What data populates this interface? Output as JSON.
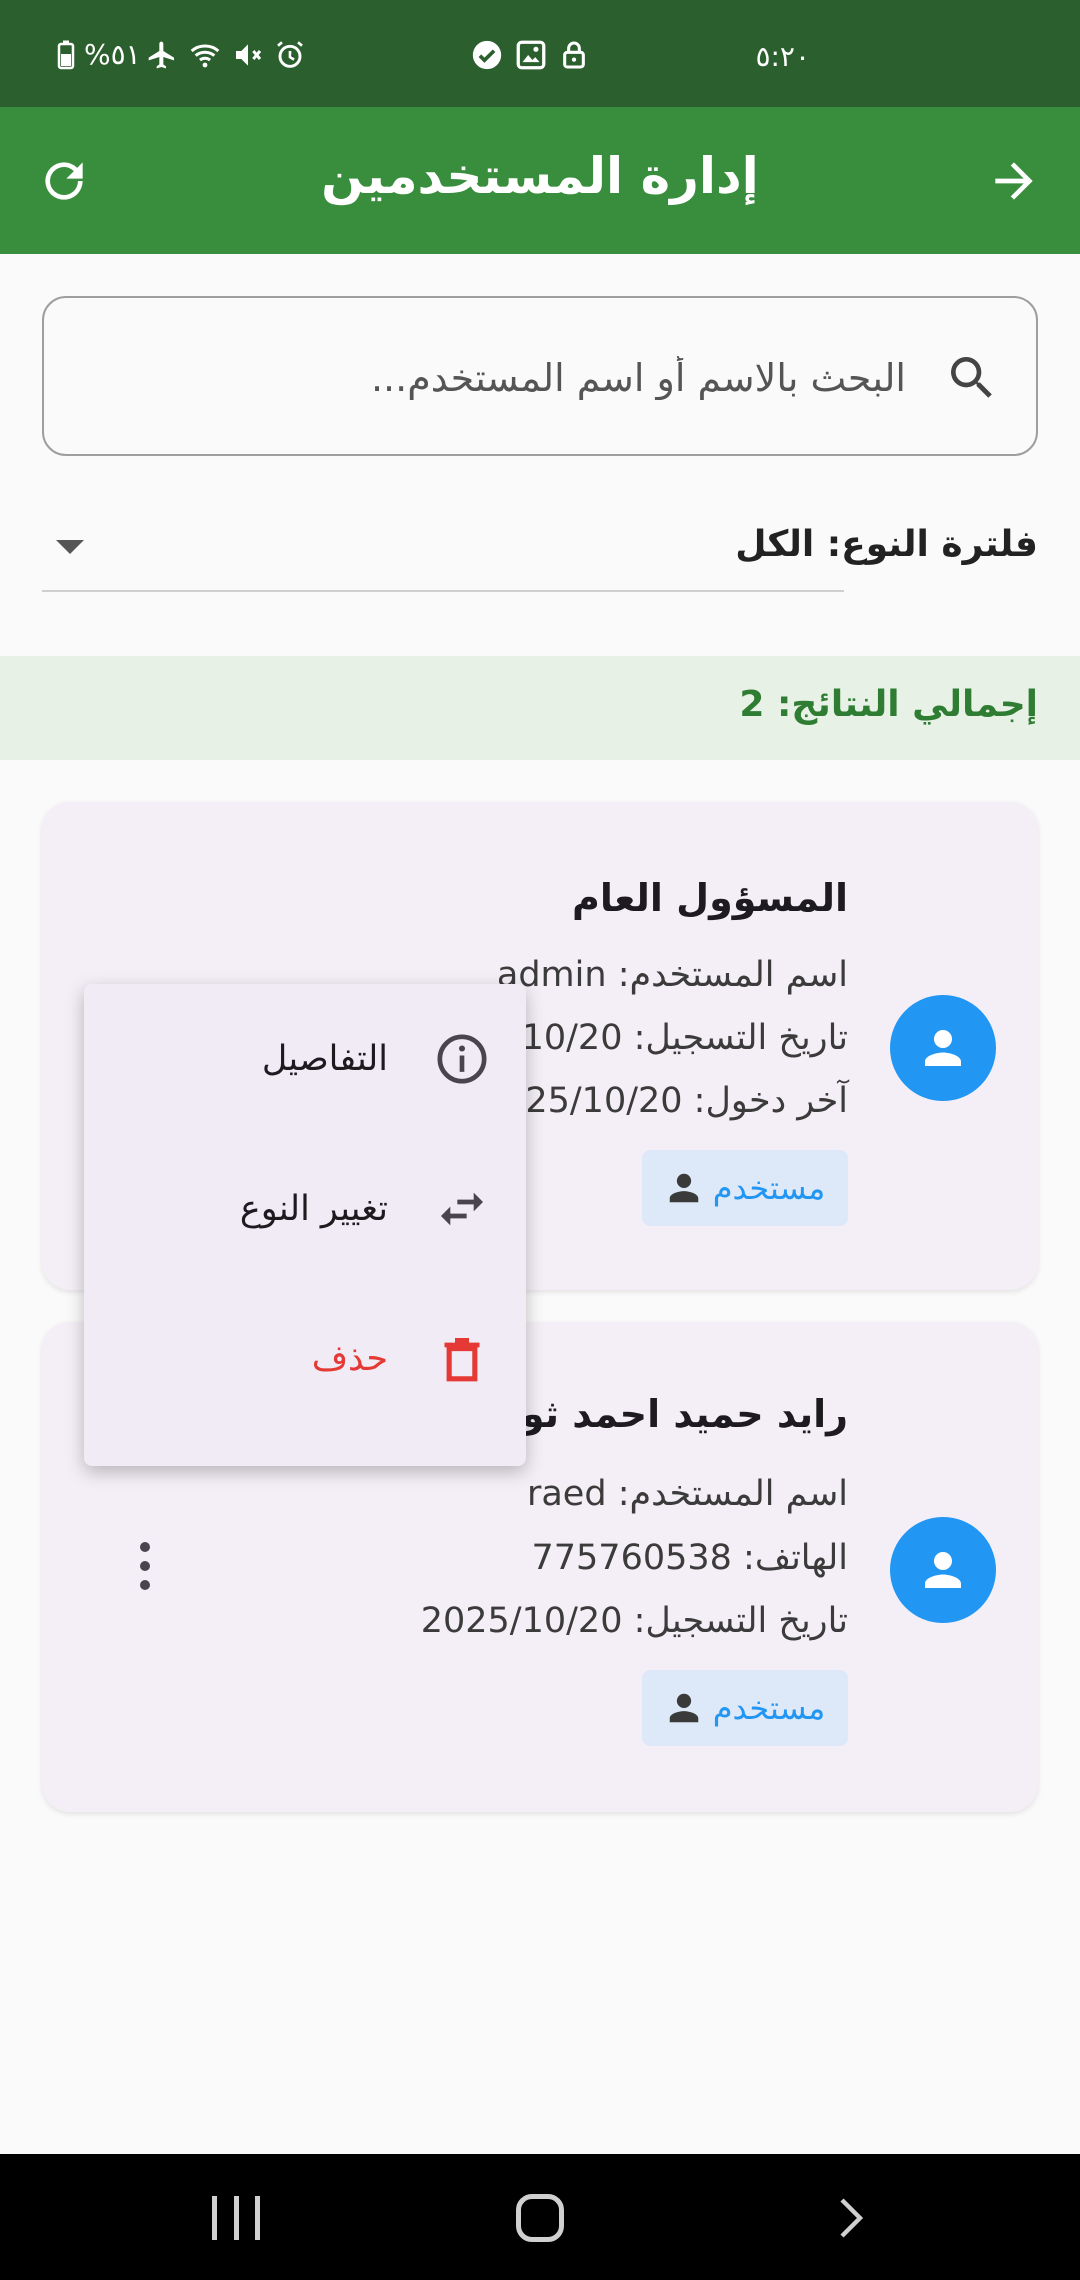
{
  "status_bar": {
    "time": "٥:٢٠",
    "battery": "%٥١"
  },
  "app_bar": {
    "title": "إدارة المستخدمين"
  },
  "search": {
    "placeholder": "البحث بالاسم أو اسم المستخدم..."
  },
  "filter": {
    "label": "فلترة النوع: الكل"
  },
  "results": {
    "text": "إجمالي النتائج: 2"
  },
  "users": [
    {
      "name": "المسؤول العام",
      "line1": "اسم المستخدم: admin",
      "line2": "تاريخ التسجيل: 2025/10/20",
      "line3": "آخر دخول: 2025/10/20",
      "role": "مستخدم"
    },
    {
      "name": "رايد حميد احمد ثوابة",
      "line1": "اسم المستخدم: raed",
      "line2": "الهاتف: 775760538",
      "line3": "تاريخ التسجيل: 2025/10/20",
      "role": "مستخدم"
    }
  ],
  "menu": {
    "items": [
      {
        "label": "التفاصيل",
        "icon": "info-icon"
      },
      {
        "label": "تغيير النوع",
        "icon": "swap-icon"
      },
      {
        "label": "حذف",
        "icon": "delete-icon"
      }
    ]
  },
  "colors": {
    "status_bar": "#2c5f2e",
    "app_bar": "#388e3c",
    "accent_blue": "#2196f3",
    "results_green": "#2e7d32",
    "delete_red": "#e53935"
  }
}
